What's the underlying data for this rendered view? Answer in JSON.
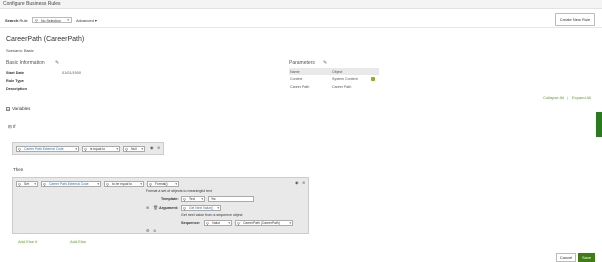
{
  "window_title": "Configure Business Rules",
  "search": {
    "label_prefix": "Search",
    "label_suffix": ":Rule",
    "value": "No Selection",
    "advanced": "Advanced"
  },
  "create_new_rule": "Create New Rule",
  "rule_title": "CareerPath (CareerPath)",
  "scenario": "Scenario: Basic",
  "basic_info": {
    "heading": "Basic Information",
    "fields": [
      {
        "label": "Start Date",
        "value": "01/01/1900"
      },
      {
        "label": "Rule Type",
        "value": ""
      },
      {
        "label": "Description",
        "value": ""
      }
    ]
  },
  "parameters": {
    "heading": "Parameters",
    "columns": [
      "Name",
      "Object"
    ],
    "rows": [
      {
        "name": "Context",
        "object": "System Content"
      },
      {
        "name": "Career Path",
        "object": "Career Path"
      }
    ]
  },
  "links": {
    "collapse_all": "Collapse All",
    "separator": "|",
    "expand_all": "Expand All"
  },
  "variables": "Variables",
  "if_label": "If",
  "if_condition": {
    "field": "Career Path.External Code",
    "operator": "is equal to",
    "value": "Null"
  },
  "then_label": "Then",
  "then_action": {
    "action": "Set",
    "field": "Career Path.External Code",
    "operator": "to be equal to",
    "function": "Format()",
    "function_desc": "Format a set of objects to meaningful text",
    "template_label": "Template:",
    "template_type": "Text",
    "template_value": "%s",
    "argument_label": "Argument:",
    "argument_value": "Get Next Value()",
    "argument_desc": "Get next value from a sequence object",
    "sequence_label": "Sequence:",
    "sequence_type": "Value",
    "sequence_value": "CareerPath (CareerPath)"
  },
  "add_else_if": "Add Else If",
  "add_else": "Add Else",
  "buttons": {
    "cancel": "Cancel",
    "save": "Save"
  },
  "colors": {
    "accent": "#5b9e2c",
    "save_bg": "#3e7d12",
    "link_blue": "#2a6ebb"
  }
}
